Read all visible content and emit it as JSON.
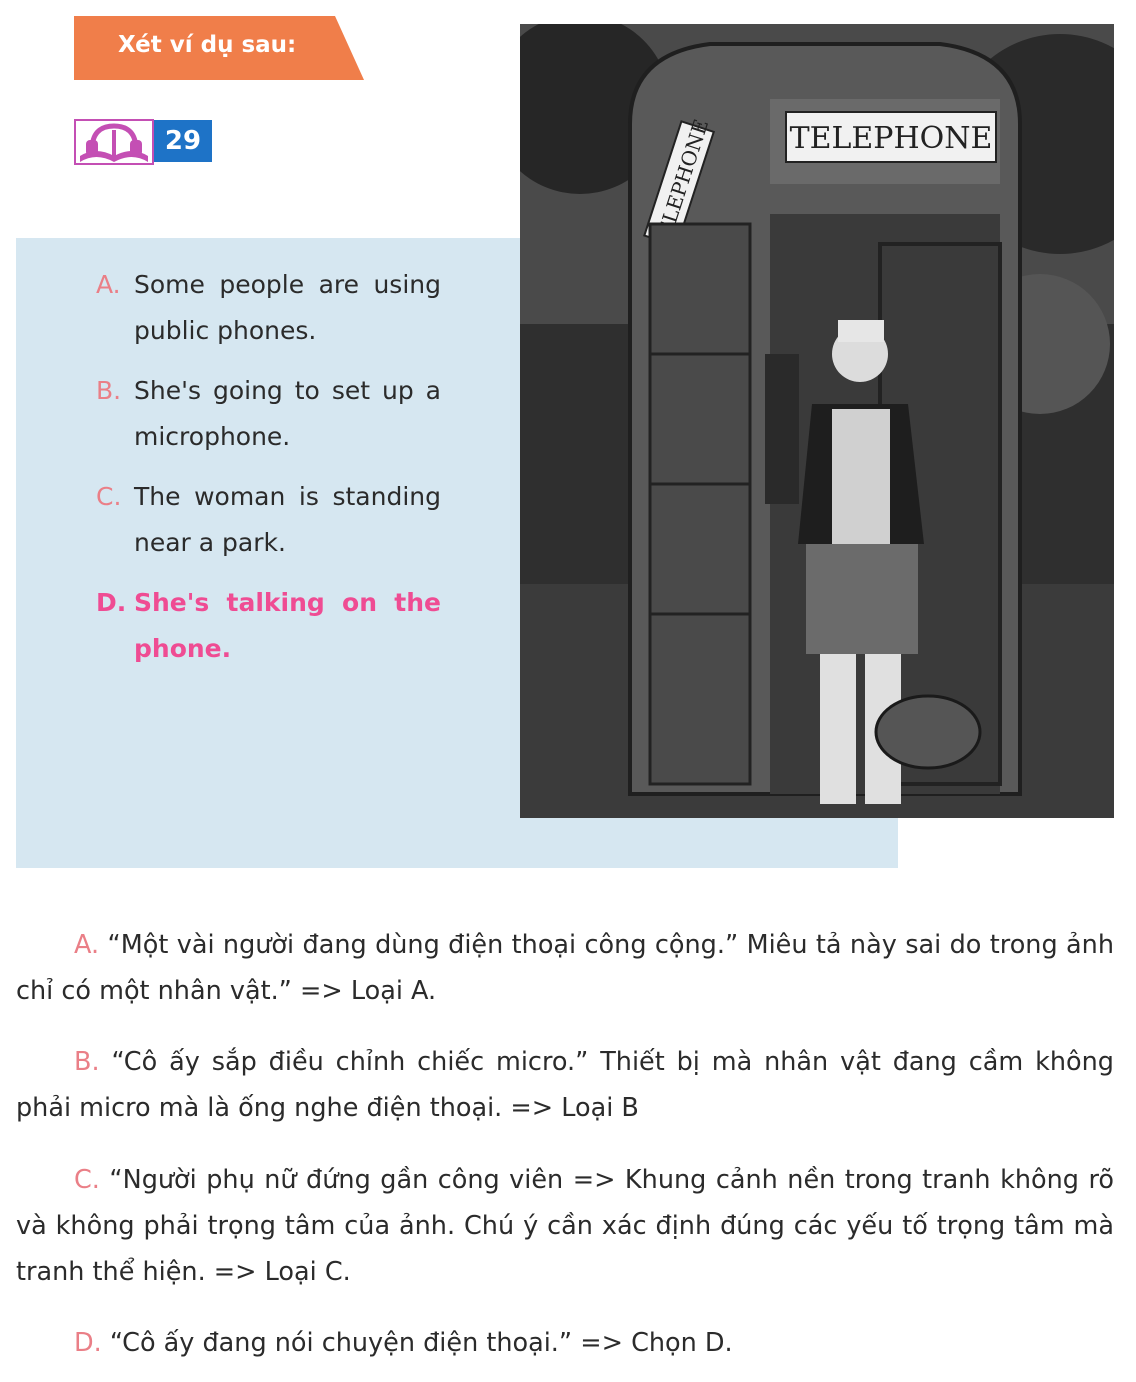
{
  "banner": {
    "title": "Xét ví dụ sau:"
  },
  "audio": {
    "icon": "headphones-book-icon",
    "track": "29"
  },
  "photo": {
    "sign_front": "TELEPHONE",
    "sign_side": "TELEPHONE"
  },
  "options": [
    {
      "letter": "A.",
      "text": "Some people are using public phones.",
      "correct": false
    },
    {
      "letter": "B.",
      "text": "She's going to set up a microphone.",
      "correct": false
    },
    {
      "letter": "C.",
      "text": "The woman is standing near a park.",
      "correct": false
    },
    {
      "letter": "D.",
      "text": "She's talking on the phone.",
      "correct": true
    }
  ],
  "explanations": [
    {
      "label": "A.",
      "text": "“Một vài người đang dùng điện thoại công cộng.” Miêu tả này sai do trong ảnh chỉ có một nhân vật.” => Loại A."
    },
    {
      "label": "B.",
      "text": "“Cô ấy sắp điều chỉnh chiếc micro.” Thiết bị mà nhân vật đang cầm không phải micro mà là ống nghe điện thoại. => Loại B"
    },
    {
      "label": "C.",
      "text": "“Người phụ nữ đứng gần công viên => Khung cảnh nền trong tranh không rõ và không phải trọng tâm của ảnh. Chú ý cần xác định đúng các yếu tố trọng tâm mà tranh thể hiện. => Loại C."
    },
    {
      "label": "D.",
      "text": "“Cô ấy đang nói chuyện điện thoại.” => Chọn D."
    }
  ],
  "colors": {
    "banner": "#f07e4a",
    "track_box": "#1e73c7",
    "panel": "#d6e7f1",
    "option_letter": "#ea7f87",
    "correct": "#ef4c93"
  }
}
